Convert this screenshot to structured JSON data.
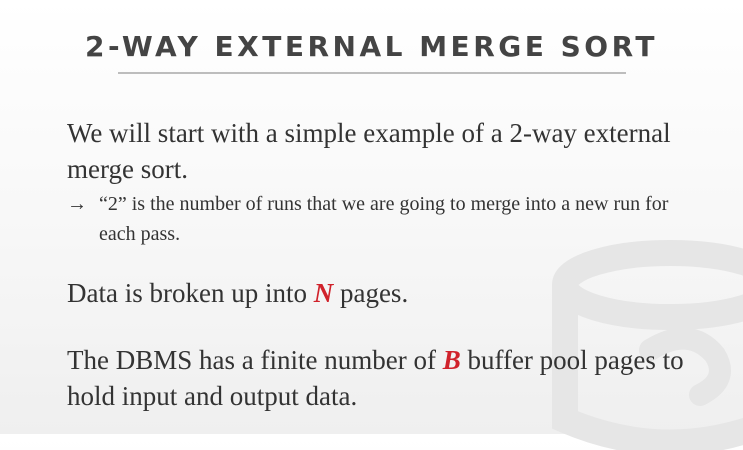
{
  "slide": {
    "title": "2-WAY EXTERNAL MERGE SORT",
    "bullets": [
      {
        "text": "We will start with a simple example of a 2-way external merge sort.",
        "sub": {
          "arrow": "→",
          "text": "“2” is the number of runs that we are going to merge into a new run for each pass."
        }
      },
      {
        "before": "Data is broken up into ",
        "highlight": "N",
        "after": " pages."
      },
      {
        "before": "The DBMS has a finite number of ",
        "highlight": "B",
        "after": " buffer pool pages to hold input and output data."
      }
    ]
  },
  "colors": {
    "accent": "#d0222b",
    "text": "#333333",
    "title": "#444444",
    "rule": "#bdbdbd",
    "watermark": "#e6e6e6"
  },
  "icons": {
    "watermark": "database-logo-icon"
  }
}
